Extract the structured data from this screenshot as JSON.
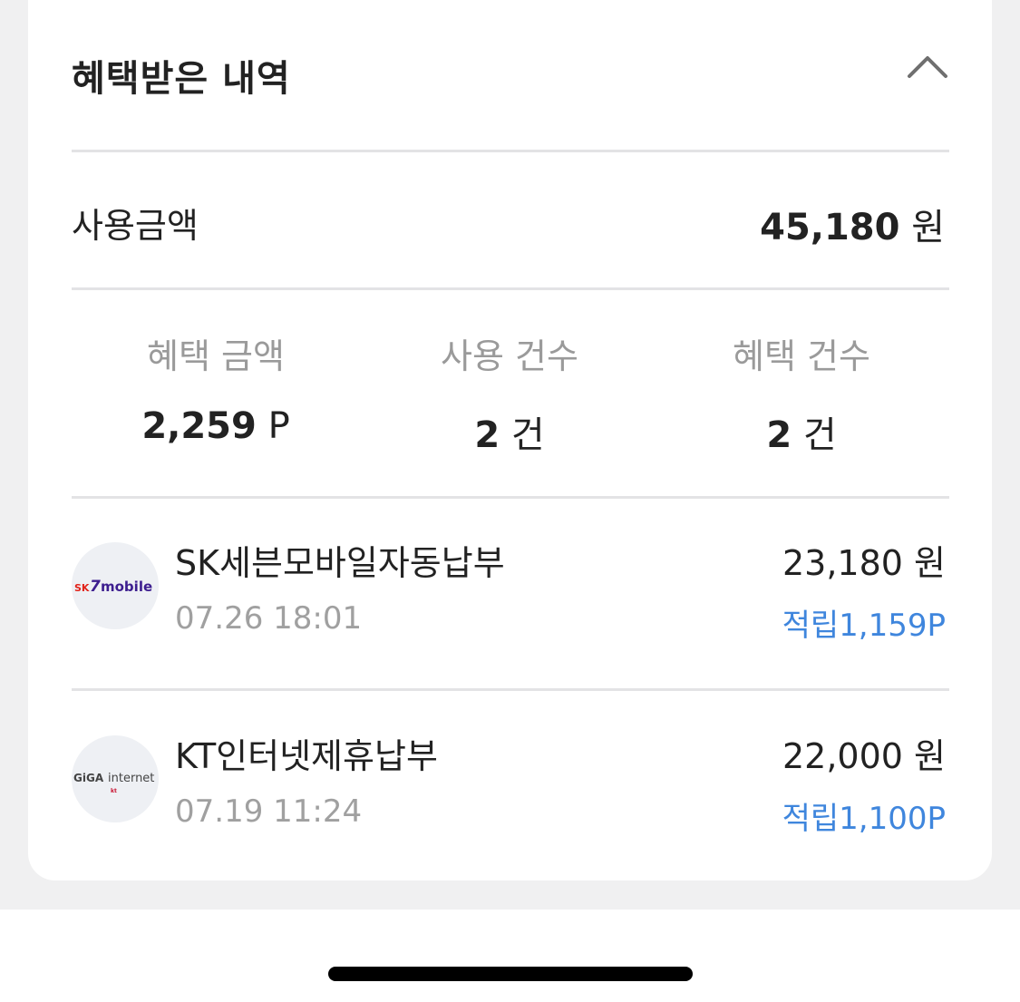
{
  "section": {
    "title": "혜택받은 내역",
    "collapse_icon": "chevron-up-icon"
  },
  "summary": {
    "total_label": "사용금액",
    "total_amount": "45,180",
    "currency_unit": "원"
  },
  "stats": [
    {
      "label": "혜택 금액",
      "value": "2,259",
      "unit": "P"
    },
    {
      "label": "사용 건수",
      "value": "2",
      "unit": "건"
    },
    {
      "label": "혜택 건수",
      "value": "2",
      "unit": "건"
    }
  ],
  "transactions": [
    {
      "merchant": "SK세븐모바일자동납부",
      "datetime": "07.26 18:01",
      "amount": "23,180 원",
      "points": "적립1,159P",
      "logo": {
        "name": "sk-7mobile-logo",
        "text_sk": "SK",
        "text_7": "7",
        "text_mobile": "mobile"
      }
    },
    {
      "merchant": "KT인터넷제휴납부",
      "datetime": "07.19 11:24",
      "amount": "22,000 원",
      "points": "적립1,100P",
      "logo": {
        "name": "giga-internet-logo",
        "text_giga": "GiGA",
        "text_internet": "internet",
        "text_kt": "kt"
      }
    }
  ],
  "colors": {
    "accent_points": "#3f86dd",
    "text_primary": "#222222",
    "text_secondary": "#9a9a9a",
    "divider": "#e3e3e5",
    "backdrop": "#f0f0f1"
  }
}
